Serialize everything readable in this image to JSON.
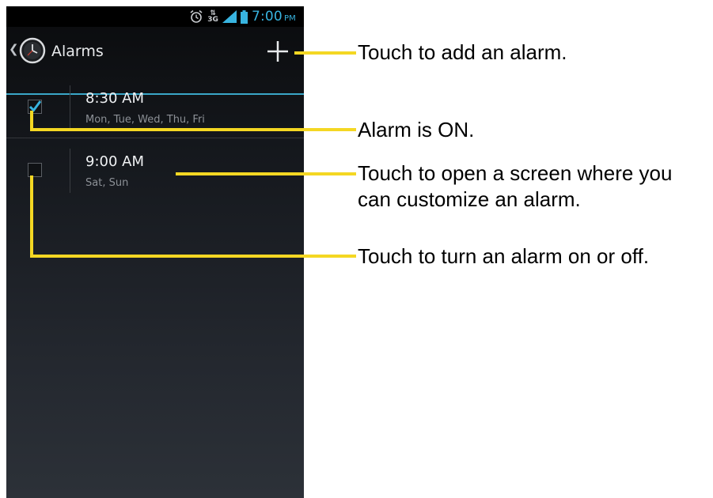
{
  "status_bar": {
    "network": "3G",
    "time": "7:00",
    "ampm": "PM"
  },
  "action_bar": {
    "title": "Alarms"
  },
  "alarms": [
    {
      "time": "8:30 AM",
      "days": "Mon, Tue, Wed, Thu, Fri",
      "enabled": true
    },
    {
      "time": "9:00 AM",
      "days": "Sat, Sun",
      "enabled": false
    }
  ],
  "callouts": {
    "add": "Touch to add an alarm.",
    "on": "Alarm is ON.",
    "customize_line1": "Touch to open a screen where you",
    "customize_line2": "can customize an alarm.",
    "toggle": "Touch to turn an alarm on or off."
  },
  "colors": {
    "accent": "#38b4e0",
    "callout": "#f4d723"
  },
  "icons": [
    "alarm-clock-icon",
    "signal-icon",
    "battery-icon",
    "back-icon",
    "clock-app-icon",
    "plus-icon",
    "checkmark-icon"
  ]
}
